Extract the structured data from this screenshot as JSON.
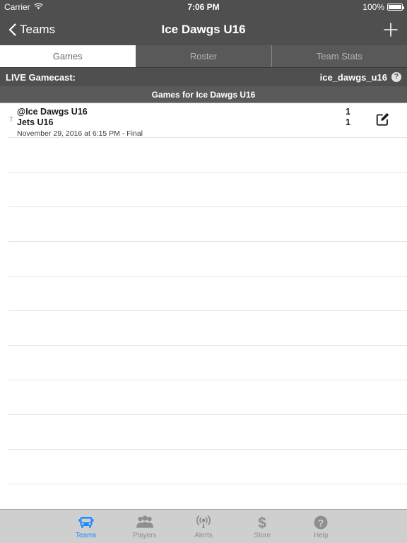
{
  "status_bar": {
    "carrier": "Carrier",
    "wifi_icon": "wifi-icon",
    "time": "7:06 PM",
    "battery_percent": "100%",
    "battery_icon": "battery-icon"
  },
  "nav_bar": {
    "back_icon": "chevron-left-icon",
    "back_label": "Teams",
    "title": "Ice Dawgs U16",
    "add_icon": "plus-icon"
  },
  "segmented_control": {
    "selected_index": 0,
    "segments": [
      {
        "label": "Games"
      },
      {
        "label": "Roster"
      },
      {
        "label": "Team Stats"
      }
    ]
  },
  "gamecast_bar": {
    "label": "LIVE Gamecast:",
    "value": "ice_dawgs_u16",
    "help_icon": "question-mark-circle-icon",
    "help_glyph": "?"
  },
  "section_header": {
    "title": "Games for Ice Dawgs U16"
  },
  "games": [
    {
      "marker": "T",
      "away_team": "@Ice Dawgs U16",
      "away_score": "1",
      "home_team": "Jets U16",
      "home_score": "1",
      "meta": "November 29, 2016 at 6:15 PM  - Final",
      "edit_icon": "compose-edit-icon"
    }
  ],
  "empty_rows": 11,
  "tab_bar": {
    "selected_index": 0,
    "tabs": [
      {
        "label": "Teams",
        "icon": "teams-bus-icon"
      },
      {
        "label": "Players",
        "icon": "people-group-icon"
      },
      {
        "label": "Alerts",
        "icon": "broadcast-antenna-icon"
      },
      {
        "label": "Store",
        "icon": "dollar-sign-icon"
      },
      {
        "label": "Help",
        "icon": "question-mark-circle-icon"
      }
    ]
  },
  "colors": {
    "chrome": "#4f4f4f",
    "segment_inactive": "#595959",
    "section_header": "#5a5a5a",
    "accent": "#1a8cff",
    "tabbar_bg": "#cfcfcf",
    "separator": "#e3e3e3"
  }
}
